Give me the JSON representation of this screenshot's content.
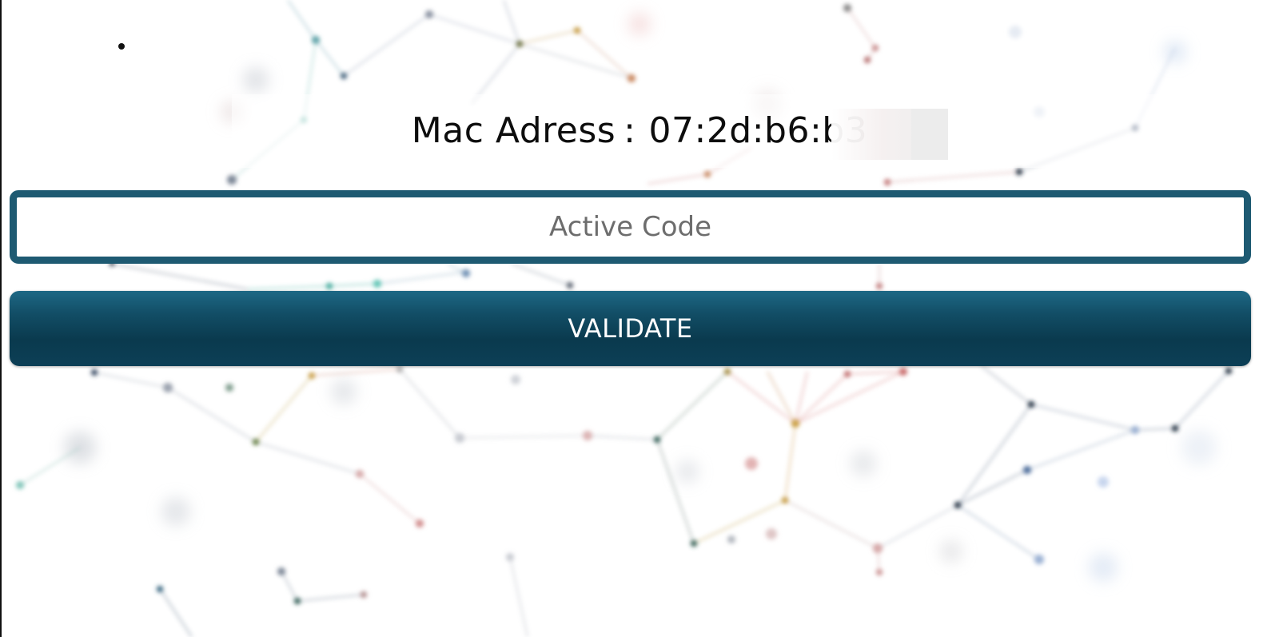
{
  "device": {
    "mac_label": "Mac Adress",
    "mac_separator": ":",
    "mac_value": "07:2d:b6:b3"
  },
  "activation": {
    "code_placeholder": "Active Code",
    "code_value": ""
  },
  "actions": {
    "validate_label": "VALIDATE"
  },
  "theme": {
    "accent": "#1e5a72",
    "button_top": "#1e6885",
    "button_bottom": "#0a3a4e",
    "text": "#0d0d0d",
    "placeholder": "#6d6d6d"
  }
}
